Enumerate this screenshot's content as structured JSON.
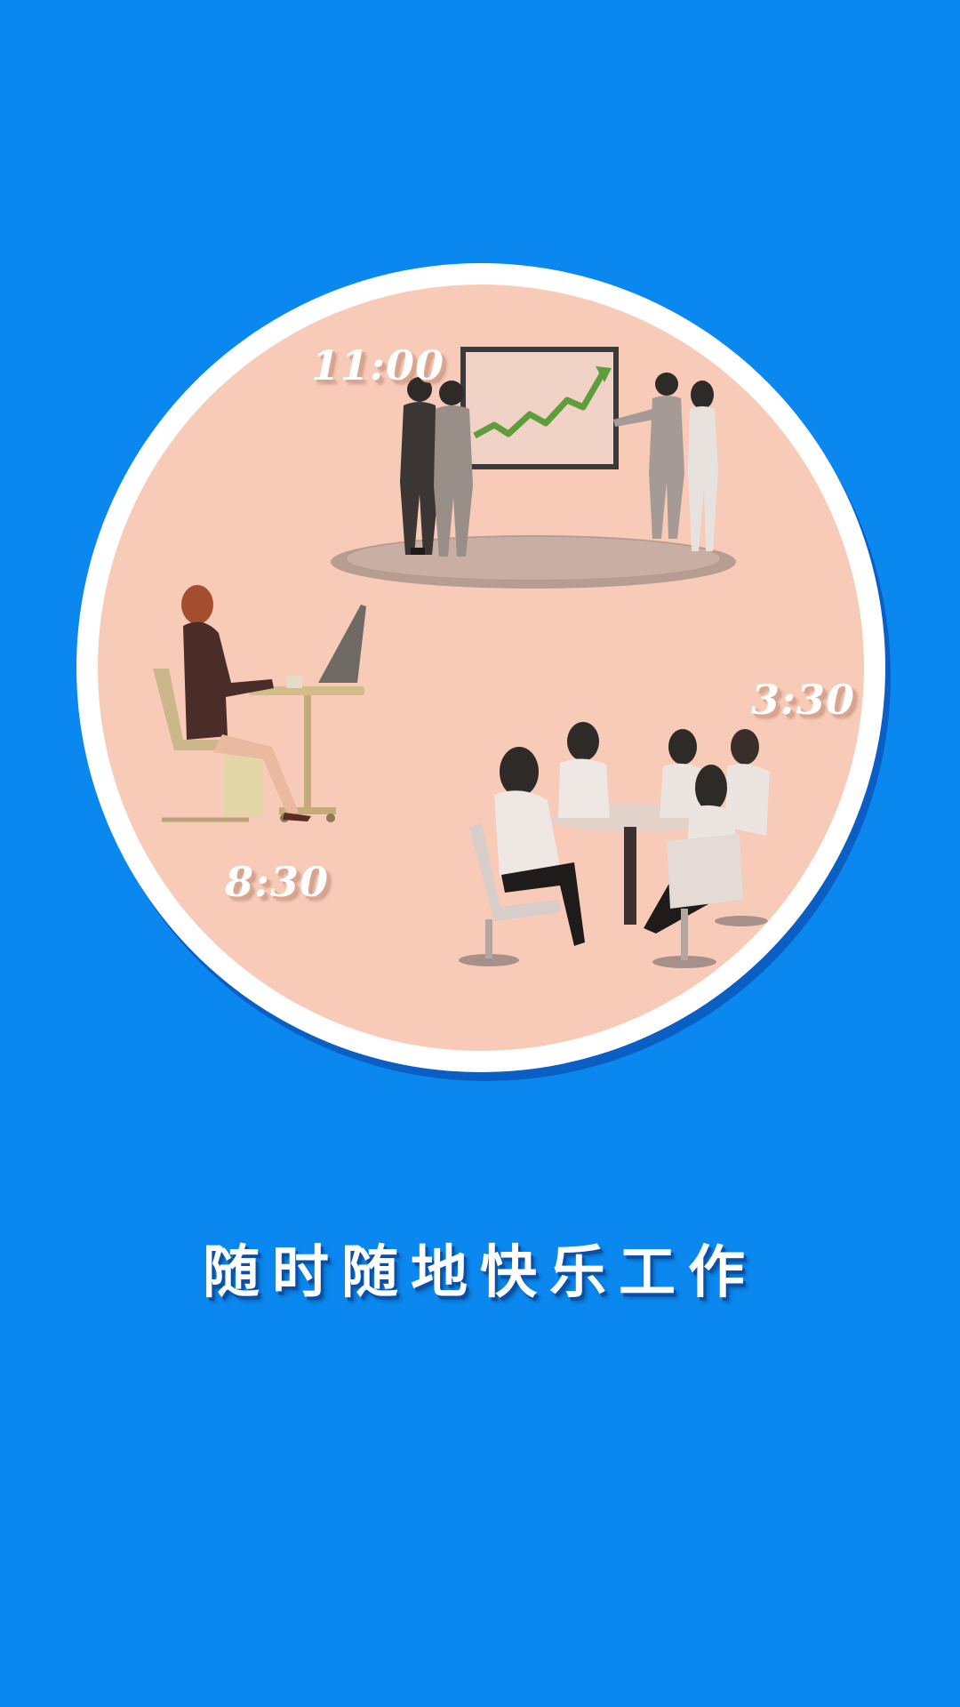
{
  "splash": {
    "times": {
      "meeting": "11:00",
      "afternoon": "3:30",
      "morning": "8:30"
    },
    "slogan": "随时随地快乐工作"
  },
  "colors": {
    "background": "#0a88f0",
    "circle_border": "#ffffff",
    "circle_fill": "#f8cbb8",
    "chart_line": "#5e9e3a"
  },
  "illustrations": [
    "business-presentation-illustration",
    "woman-at-laptop-illustration",
    "team-meeting-illustration"
  ]
}
